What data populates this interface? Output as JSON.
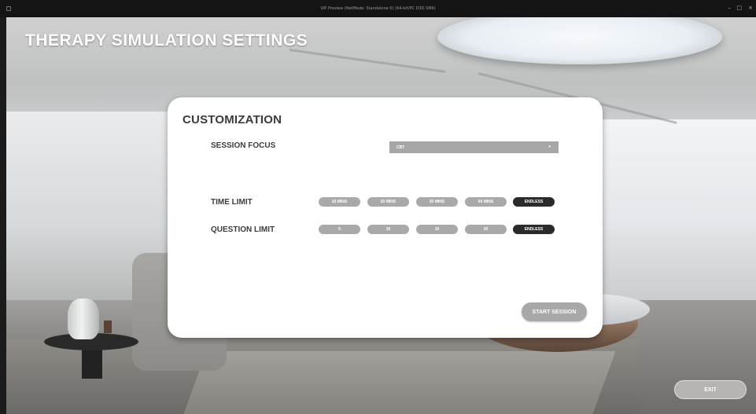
{
  "window": {
    "title": "VIP Preview (NetMode: Standalone 0) (64-bit/PC D3D SM6)",
    "controls": {
      "minimize": "–",
      "maximize": "□",
      "close": "×"
    }
  },
  "page": {
    "title": "THERAPY SIMULATION SETTINGS"
  },
  "panel": {
    "heading": "CUSTOMIZATION",
    "session_focus": {
      "label": "SESSION FOCUS",
      "selected": "CBT",
      "chevron": "▾"
    },
    "time_limit": {
      "label": "TIME LIMIT",
      "options": [
        "10 MINS",
        "20 MINS",
        "30 MINS",
        "60 MINS",
        "ENDLESS"
      ],
      "selected": "ENDLESS"
    },
    "question_limit": {
      "label": "QUESTION LIMIT",
      "options": [
        "5",
        "10",
        "15",
        "20",
        "ENDLESS"
      ],
      "selected": "ENDLESS"
    },
    "start_button": "START SESSION"
  },
  "exit_button": "EXIT",
  "colors": {
    "option_inactive": "#a9a9a9",
    "option_active": "#2a2a2a",
    "panel_bg": "#ffffff",
    "title_text": "#ffffff"
  }
}
